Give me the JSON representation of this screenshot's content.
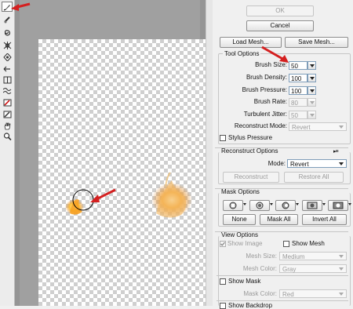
{
  "toolbar": {
    "tools": [
      {
        "icon": "forward-warp-icon",
        "active": true
      },
      {
        "icon": "reconstruct-icon"
      },
      {
        "icon": "twirl-icon"
      },
      {
        "icon": "pucker-icon"
      },
      {
        "icon": "bloat-icon"
      },
      {
        "icon": "push-left-icon"
      },
      {
        "icon": "mirror-icon"
      },
      {
        "icon": "turbulence-icon"
      },
      {
        "icon": "freeze-mask-icon"
      },
      {
        "icon": "thaw-mask-icon"
      },
      {
        "icon": "hand-icon"
      },
      {
        "icon": "zoom-icon"
      }
    ]
  },
  "buttons": {
    "ok": "OK",
    "cancel": "Cancel",
    "load_mesh": "Load Mesh...",
    "save_mesh": "Save Mesh..."
  },
  "tool_options": {
    "title": "Tool Options",
    "brush_size_label": "Brush Size:",
    "brush_size": "50",
    "brush_density_label": "Brush Density:",
    "brush_density": "100",
    "brush_pressure_label": "Brush Pressure:",
    "brush_pressure": "100",
    "brush_rate_label": "Brush Rate:",
    "brush_rate": "80",
    "turbulent_jitter_label": "Turbulent Jitter:",
    "turbulent_jitter": "50",
    "reconstruct_mode_label": "Reconstruct Mode:",
    "reconstruct_mode": "Revert",
    "stylus_pressure_label": "Stylus Pressure"
  },
  "reconstruct_options": {
    "title": "Reconstruct Options",
    "mode_label": "Mode:",
    "mode": "Revert",
    "reconstruct_label": "Reconstruct",
    "restore_all_label": "Restore All"
  },
  "mask_options": {
    "title": "Mask Options",
    "none_label": "None",
    "mask_all_label": "Mask All",
    "invert_all_label": "Invert All"
  },
  "view_options": {
    "title": "View Options",
    "show_image_label": "Show Image",
    "show_image": true,
    "show_mesh_label": "Show Mesh",
    "show_mesh": false,
    "mesh_size_label": "Mesh Size:",
    "mesh_size": "Medium",
    "mesh_color_label": "Mesh Color:",
    "mesh_color": "Gray",
    "show_mask_label": "Show Mask",
    "show_mask": false,
    "mask_color_label": "Mask Color:",
    "mask_color": "Red",
    "show_backdrop_label": "Show Backdrop"
  },
  "colors": {
    "annotation_arrow": "#d42020",
    "flame_core": "#ffd54a",
    "flame_edge": "#e07a10"
  }
}
